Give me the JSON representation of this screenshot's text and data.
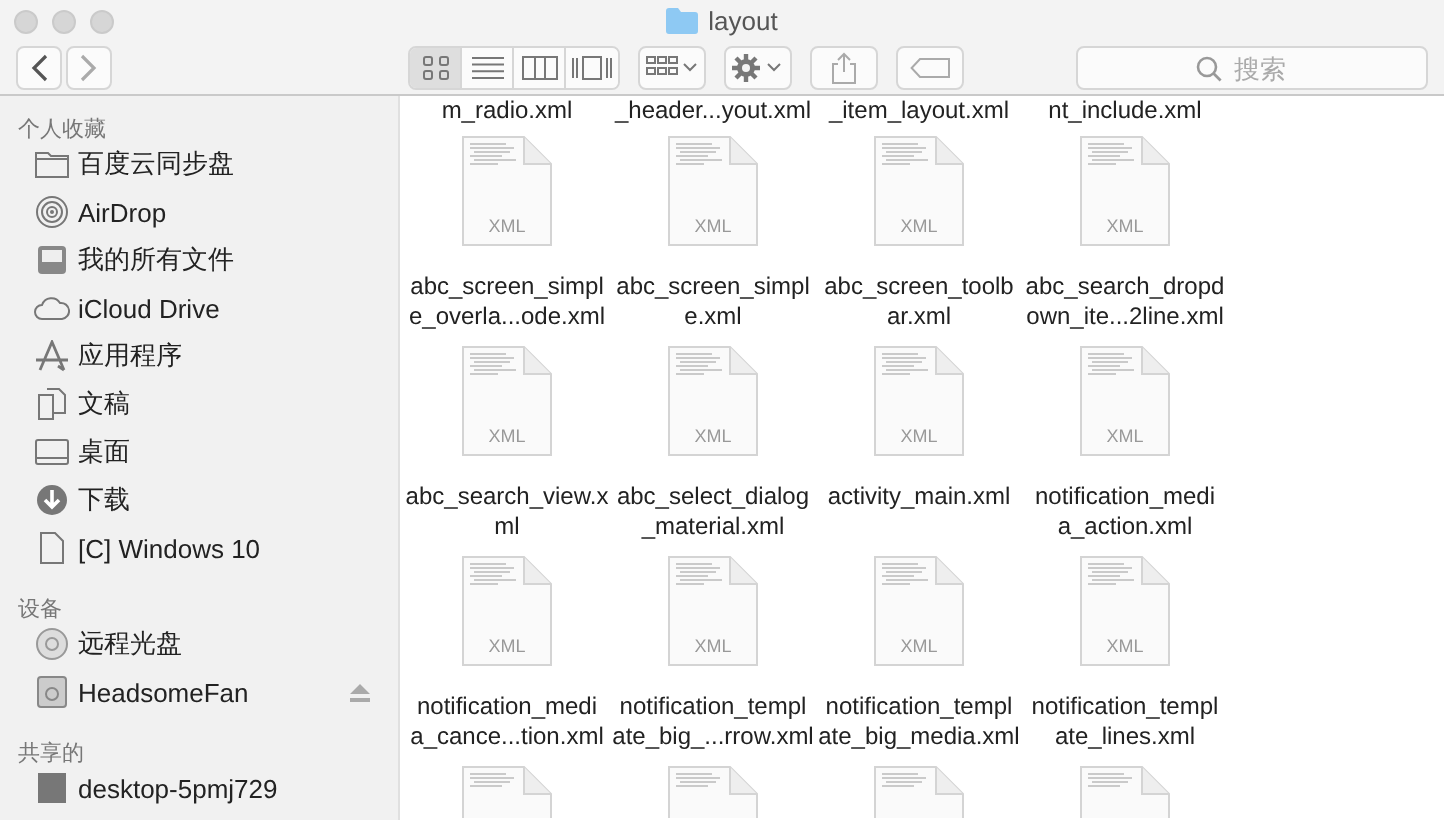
{
  "window": {
    "title": "layout"
  },
  "toolbar": {
    "view_modes": [
      {
        "kind": "icons",
        "selected": true
      },
      {
        "kind": "list",
        "selected": false
      },
      {
        "kind": "columns",
        "selected": false
      },
      {
        "kind": "coverflow",
        "selected": false
      }
    ],
    "search": {
      "placeholder": "搜索"
    }
  },
  "sidebar": {
    "sections": [
      {
        "title": "个人收藏",
        "items": [
          {
            "label": "百度云同步盘",
            "kind": "folder"
          },
          {
            "label": "AirDrop",
            "kind": "airdrop"
          },
          {
            "label": "我的所有文件",
            "kind": "allfiles"
          },
          {
            "label": "iCloud Drive",
            "kind": "cloud"
          },
          {
            "label": "应用程序",
            "kind": "apps"
          },
          {
            "label": "文稿",
            "kind": "docs"
          },
          {
            "label": "桌面",
            "kind": "desktop"
          },
          {
            "label": "下载",
            "kind": "download"
          },
          {
            "label": "[C] Windows 10",
            "kind": "file"
          }
        ]
      },
      {
        "title": "设备",
        "items": [
          {
            "label": "远程光盘",
            "kind": "disc"
          },
          {
            "label": "HeadsomeFan",
            "kind": "drive",
            "ejectable": true
          }
        ]
      },
      {
        "title": "共享的",
        "items": [
          {
            "label": "desktop-5pmj729",
            "kind": "computer"
          }
        ]
      }
    ]
  },
  "top_row_labels": [
    "m_radio.xml",
    "_header...yout.xml",
    "_item_layout.xml",
    "nt_include.xml"
  ],
  "files": [
    {
      "badge": "XML",
      "name": "abc_screen_simpl\ne_overla...ode.xml"
    },
    {
      "badge": "XML",
      "name": "abc_screen_simpl\ne.xml"
    },
    {
      "badge": "XML",
      "name": "abc_screen_toolb\nar.xml"
    },
    {
      "badge": "XML",
      "name": "abc_search_dropd\nown_ite...2line.xml"
    },
    {
      "badge": "XML",
      "name": "abc_search_view.x\nml"
    },
    {
      "badge": "XML",
      "name": "abc_select_dialog\n_material.xml"
    },
    {
      "badge": "XML",
      "name": "activity_main.xml"
    },
    {
      "badge": "XML",
      "name": "notification_medi\na_action.xml"
    },
    {
      "badge": "XML",
      "name": "notification_medi\na_cance...tion.xml"
    },
    {
      "badge": "XML",
      "name": "notification_templ\nate_big_...rrow.xml"
    },
    {
      "badge": "XML",
      "name": "notification_templ\nate_big_media.xml"
    },
    {
      "badge": "XML",
      "name": "notification_templ\nate_lines.xml"
    }
  ],
  "more_files": [
    {
      "kind": "document"
    },
    {
      "kind": "document"
    },
    {
      "kind": "document"
    },
    {
      "kind": "document"
    }
  ]
}
